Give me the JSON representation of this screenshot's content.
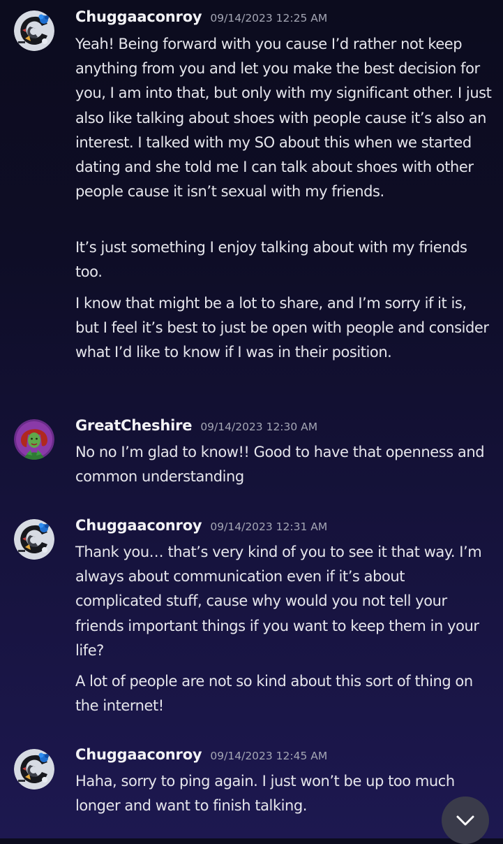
{
  "messages": [
    {
      "username": "Chuggaaconroy",
      "timestamp": "09/14/2023 12:25 AM",
      "paragraphs": [
        "Yeah! Being forward with you cause I’d rather not keep anything from you and let you make the best decision for you, I am into that, but only with my significant other. I just also like talking about shoes with people cause it’s also an interest. I talked with my SO about this when we started dating and she told me I can talk about shoes with other people cause it isn’t sexual with my friends.",
        "It’s just something I enjoy talking about with my friends too.",
        "I know that might be a lot to share, and I’m sorry if it is, but I feel it’s best to just be open with people and consider what I’d like to know if I was in their position."
      ]
    },
    {
      "username": "GreatCheshire",
      "timestamp": "09/14/2023 12:30 AM",
      "paragraphs": [
        "No no I’m glad to know!! Good to have that openness and common understanding"
      ]
    },
    {
      "username": "Chuggaaconroy",
      "timestamp": "09/14/2023 12:31 AM",
      "paragraphs": [
        "Thank you… that’s very kind of you to see it that way. I’m always about communication even if it’s about complicated stuff, cause why would you not tell your friends important things if you want to keep them in your life?",
        "A lot of people are not so kind about this sort of thing on the internet!"
      ]
    },
    {
      "username": "Chuggaaconroy",
      "timestamp": "09/14/2023 12:45 AM",
      "paragraphs": [
        "Haha, sorry to ping again. I just won’t be up too much longer and want to finish talking."
      ]
    }
  ],
  "icons": {
    "avatar_chuggaaconroy": "avatar-c-logo-icon",
    "avatar_greatcheshire": "avatar-character-icon",
    "scroll_to_bottom": "chevron-down-icon"
  },
  "colors": {
    "username": "#f2f2f5",
    "timestamp": "#a4a6b4",
    "message_text": "#e6e6ec",
    "background_top": "#0c0c1e",
    "background_bottom": "#1d1850",
    "scroll_button": "#3a3b4a"
  }
}
